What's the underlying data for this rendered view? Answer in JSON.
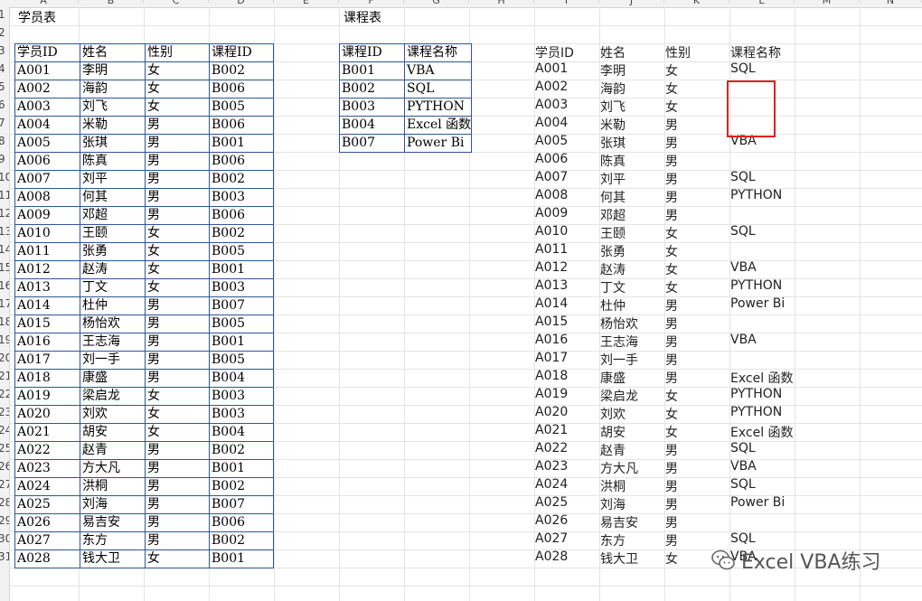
{
  "columns": [
    "A",
    "B",
    "C",
    "D",
    "E",
    "F",
    "G",
    "H",
    "I",
    "J",
    "K",
    "L",
    "M",
    "N"
  ],
  "row_numbers": [
    "1",
    "2",
    "3",
    "4",
    "5",
    "6",
    "7",
    "8",
    "9",
    "10",
    "11",
    "12",
    "13",
    "14",
    "15",
    "16",
    "17",
    "18",
    "19",
    "20",
    "21",
    "22",
    "23",
    "24",
    "25",
    "26",
    "27",
    "28",
    "29",
    "30",
    "31"
  ],
  "student_table": {
    "title": "学员表",
    "headers": [
      "学员ID",
      "姓名",
      "性别",
      "课程ID"
    ],
    "rows": [
      [
        "A001",
        "李明",
        "女",
        "B002"
      ],
      [
        "A002",
        "海韵",
        "女",
        "B006"
      ],
      [
        "A003",
        "刘飞",
        "女",
        "B005"
      ],
      [
        "A004",
        "米勒",
        "男",
        "B006"
      ],
      [
        "A005",
        "张琪",
        "男",
        "B001"
      ],
      [
        "A006",
        "陈真",
        "男",
        "B006"
      ],
      [
        "A007",
        "刘平",
        "男",
        "B002"
      ],
      [
        "A008",
        "何其",
        "男",
        "B003"
      ],
      [
        "A009",
        "邓超",
        "男",
        "B006"
      ],
      [
        "A010",
        "王颐",
        "女",
        "B002"
      ],
      [
        "A011",
        "张勇",
        "女",
        "B005"
      ],
      [
        "A012",
        "赵涛",
        "女",
        "B001"
      ],
      [
        "A013",
        "丁文",
        "女",
        "B003"
      ],
      [
        "A014",
        "杜仲",
        "男",
        "B007"
      ],
      [
        "A015",
        "杨怡欢",
        "男",
        "B005"
      ],
      [
        "A016",
        "王志海",
        "男",
        "B001"
      ],
      [
        "A017",
        "刘一手",
        "男",
        "B005"
      ],
      [
        "A018",
        "康盛",
        "男",
        "B004"
      ],
      [
        "A019",
        "梁启龙",
        "女",
        "B003"
      ],
      [
        "A020",
        "刘欢",
        "女",
        "B003"
      ],
      [
        "A021",
        "胡安",
        "女",
        "B004"
      ],
      [
        "A022",
        "赵青",
        "男",
        "B002"
      ],
      [
        "A023",
        "方大凡",
        "男",
        "B001"
      ],
      [
        "A024",
        "洪桐",
        "男",
        "B002"
      ],
      [
        "A025",
        "刘海",
        "男",
        "B007"
      ],
      [
        "A026",
        "易吉安",
        "男",
        "B006"
      ],
      [
        "A027",
        "东方",
        "男",
        "B002"
      ],
      [
        "A028",
        "钱大卫",
        "女",
        "B001"
      ]
    ]
  },
  "course_table": {
    "title": "课程表",
    "headers": [
      "课程ID",
      "课程名称"
    ],
    "rows": [
      [
        "B001",
        "VBA"
      ],
      [
        "B002",
        "SQL"
      ],
      [
        "B003",
        "PYTHON"
      ],
      [
        "B004",
        "Excel 函数"
      ],
      [
        "B007",
        "Power Bi"
      ]
    ]
  },
  "result_table": {
    "headers": [
      "学员ID",
      "姓名",
      "性别",
      "课程名称"
    ],
    "rows": [
      [
        "A001",
        "李明",
        "女",
        "SQL"
      ],
      [
        "A002",
        "海韵",
        "女",
        ""
      ],
      [
        "A003",
        "刘飞",
        "女",
        ""
      ],
      [
        "A004",
        "米勒",
        "男",
        ""
      ],
      [
        "A005",
        "张琪",
        "男",
        "VBA"
      ],
      [
        "A006",
        "陈真",
        "男",
        ""
      ],
      [
        "A007",
        "刘平",
        "男",
        "SQL"
      ],
      [
        "A008",
        "何其",
        "男",
        "PYTHON"
      ],
      [
        "A009",
        "邓超",
        "男",
        ""
      ],
      [
        "A010",
        "王颐",
        "女",
        "SQL"
      ],
      [
        "A011",
        "张勇",
        "女",
        ""
      ],
      [
        "A012",
        "赵涛",
        "女",
        "VBA"
      ],
      [
        "A013",
        "丁文",
        "女",
        "PYTHON"
      ],
      [
        "A014",
        "杜仲",
        "男",
        "Power Bi"
      ],
      [
        "A015",
        "杨怡欢",
        "男",
        ""
      ],
      [
        "A016",
        "王志海",
        "男",
        "VBA"
      ],
      [
        "A017",
        "刘一手",
        "男",
        ""
      ],
      [
        "A018",
        "康盛",
        "男",
        "Excel 函数"
      ],
      [
        "A019",
        "梁启龙",
        "女",
        "PYTHON"
      ],
      [
        "A020",
        "刘欢",
        "女",
        "PYTHON"
      ],
      [
        "A021",
        "胡安",
        "女",
        "Excel 函数"
      ],
      [
        "A022",
        "赵青",
        "男",
        "SQL"
      ],
      [
        "A023",
        "方大凡",
        "男",
        "VBA"
      ],
      [
        "A024",
        "洪桐",
        "男",
        "SQL"
      ],
      [
        "A025",
        "刘海",
        "男",
        "Power Bi"
      ],
      [
        "A026",
        "易吉安",
        "男",
        ""
      ],
      [
        "A027",
        "东方",
        "男",
        "SQL"
      ],
      [
        "A028",
        "钱大卫",
        "女",
        "VBA"
      ]
    ]
  },
  "watermark": {
    "text": "Excel VBA练习",
    "icon": "wechat-icon"
  },
  "colors": {
    "table_border": "#2f5597",
    "highlight": "#e02020",
    "header_bg": "#f2f2f2"
  }
}
